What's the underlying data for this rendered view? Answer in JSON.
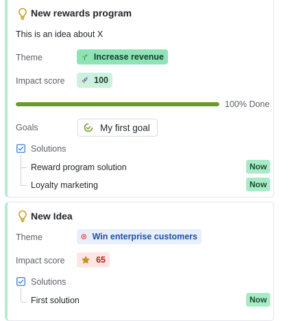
{
  "ideas": [
    {
      "title": "New rewards program",
      "description": "This is an idea about X",
      "theme_label": "Theme",
      "theme_value": "Increase revenue",
      "theme_icon": "seedling-icon",
      "impact_label": "Impact score",
      "impact_value": "100",
      "impact_icon": "rocket-icon",
      "progress_percent": 100,
      "progress_text": "100% Done",
      "goals_label": "Goals",
      "goal_value": "My first goal",
      "solutions_label": "Solutions",
      "solutions": [
        {
          "name": "Reward program solution",
          "status": "Now"
        },
        {
          "name": "Loyalty marketing",
          "status": "Now"
        }
      ]
    },
    {
      "title": "New Idea",
      "theme_label": "Theme",
      "theme_value": "Win enterprise customers",
      "theme_icon": "target-icon",
      "impact_label": "Impact score",
      "impact_value": "65",
      "impact_icon": "star-icon",
      "solutions_label": "Solutions",
      "solutions": [
        {
          "name": "First solution",
          "status": "Now"
        }
      ]
    }
  ],
  "colors": {
    "card_accent": "#b6ebd0",
    "progress": "#6a9b2a",
    "now_badge": "#a8ebc7",
    "theme_green_bg": "#8fe3b6",
    "theme_blue_bg": "#e7effc",
    "impact_green_bg": "#cdf1df",
    "impact_red_bg": "#fde6e3"
  }
}
